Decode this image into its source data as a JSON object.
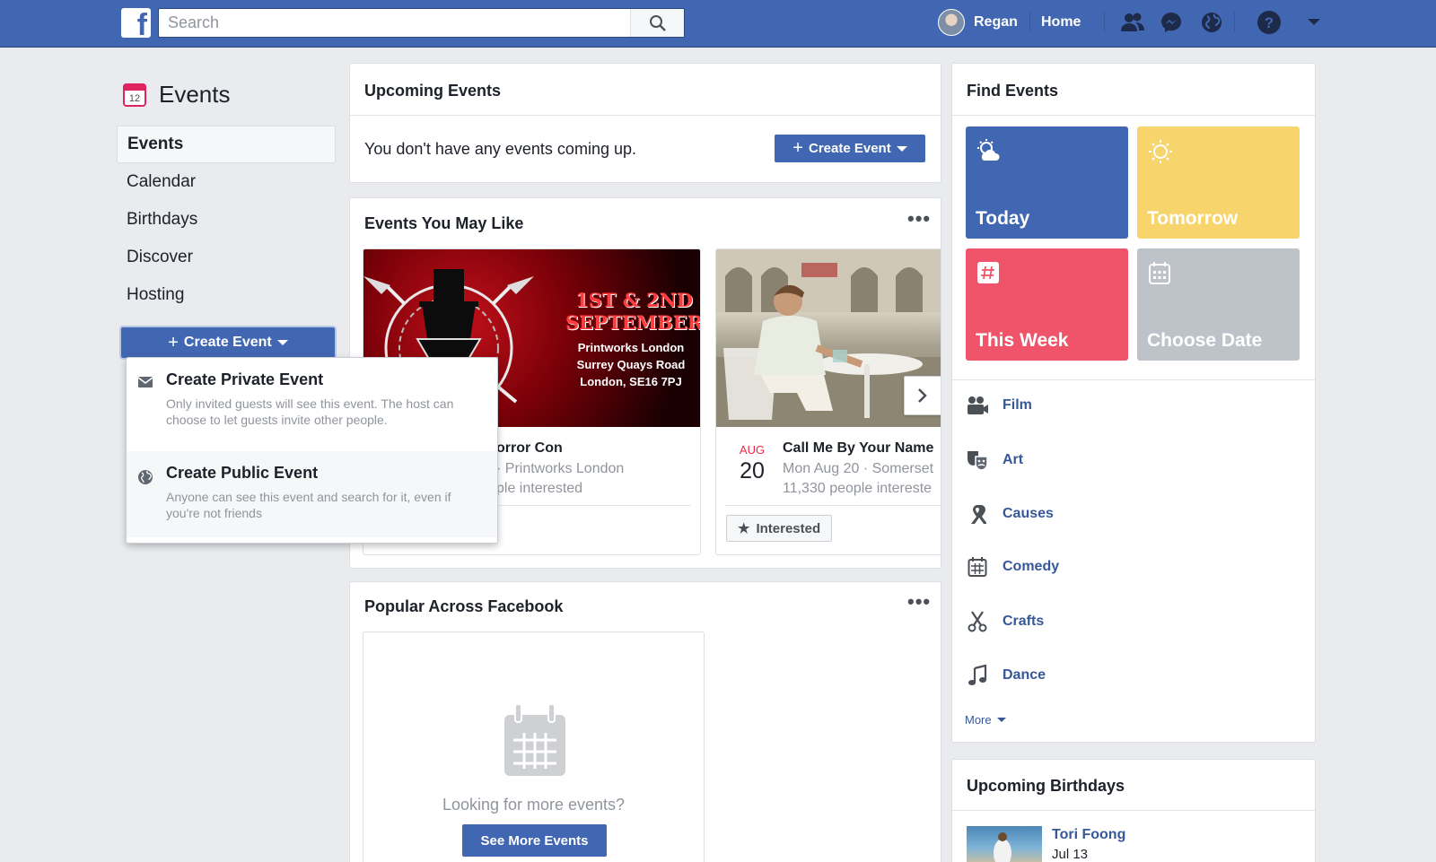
{
  "topbar": {
    "search_placeholder": "Search",
    "user_name": "Regan",
    "home_label": "Home",
    "brand_color": "#4267b2"
  },
  "sidebar": {
    "title": "Events",
    "calendar_day": "12",
    "items": [
      {
        "label": "Events",
        "active": true
      },
      {
        "label": "Calendar"
      },
      {
        "label": "Birthdays"
      },
      {
        "label": "Discover"
      },
      {
        "label": "Hosting"
      }
    ],
    "create_button": "Create Event"
  },
  "create_menu": {
    "items": [
      {
        "title": "Create Private Event",
        "desc": "Only invited guests will see this event. The host can choose to let guests invite other people.",
        "icon": "envelope-icon"
      },
      {
        "title": "Create Public Event",
        "desc": "Anyone can see this event and search for it, even if you're not friends",
        "icon": "globe-icon"
      }
    ]
  },
  "upcoming": {
    "title": "Upcoming Events",
    "empty_text": "You don't have any events coming up.",
    "create_button": "Create Event"
  },
  "may_like": {
    "title": "Events You May Like",
    "events": [
      {
        "name": "Horror Con",
        "name_visible": "orror Con",
        "place_visible": "· Printworks London",
        "interest_visible": "ple interested",
        "poster_lines": [
          "1ST & 2ND",
          "SEPTEMBER",
          "Printworks London",
          "Surrey Quays Road",
          "London, SE16 7PJ"
        ]
      },
      {
        "month": "AUG",
        "day": "20",
        "name": "Call Me By Your Name",
        "place": "Mon Aug 20 · Somerset",
        "interest": "11,330 people intereste",
        "interested_label": "Interested"
      }
    ]
  },
  "popular": {
    "title": "Popular Across Facebook",
    "empty_text": "Looking for more events?",
    "button": "See More Events"
  },
  "find_events": {
    "title": "Find Events",
    "tiles": [
      {
        "label": "Today",
        "color": "#4267b2",
        "icon": "sun-cloud-icon"
      },
      {
        "label": "Tomorrow",
        "color": "#f7d56c",
        "icon": "sun-icon"
      },
      {
        "label": "This Week",
        "color": "#f0546a",
        "icon": "calendar-week-icon"
      },
      {
        "label": "Choose Date",
        "color": "#bec2c9",
        "icon": "calendar-grid-icon"
      }
    ],
    "categories": [
      {
        "label": "Film",
        "icon": "film-camera-icon"
      },
      {
        "label": "Art",
        "icon": "theater-masks-icon"
      },
      {
        "label": "Causes",
        "icon": "ribbon-icon"
      },
      {
        "label": "Comedy",
        "icon": "calendar-icon"
      },
      {
        "label": "Crafts",
        "icon": "scissors-icon"
      },
      {
        "label": "Dance",
        "icon": "music-note-icon"
      }
    ],
    "more_label": "More"
  },
  "birthdays": {
    "title": "Upcoming Birthdays",
    "people": [
      {
        "name": "Tori Foong",
        "date": "Jul 13"
      }
    ]
  }
}
